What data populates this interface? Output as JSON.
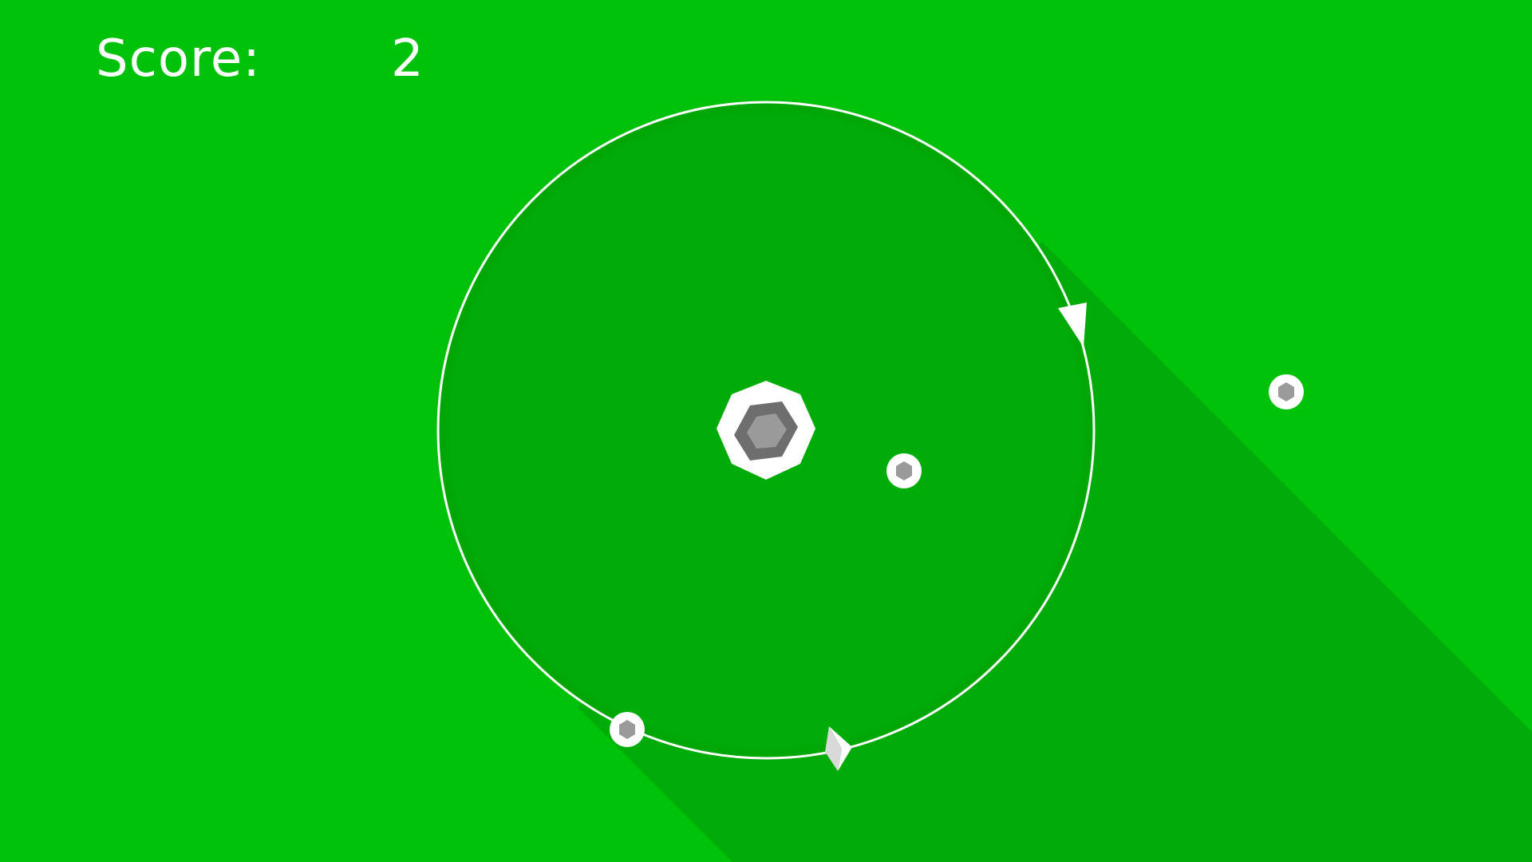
{
  "hud": {
    "score_label": "Score:",
    "score_value": "2"
  },
  "colors": {
    "background": "#00c20a",
    "shadow": "#00ac08",
    "track": "#ffffff",
    "core_dark": "#6e6e6e",
    "core_light": "#9a9a9a",
    "node_fill": "#9a9a9a"
  },
  "entities": {
    "orbit": "orbit-ring",
    "core": "hexagon-core",
    "direction_marker": "triangle-arrow-icon",
    "player": "diamond-ship-icon",
    "nodes": [
      "inner-node",
      "outer-node",
      "orbit-node"
    ]
  }
}
